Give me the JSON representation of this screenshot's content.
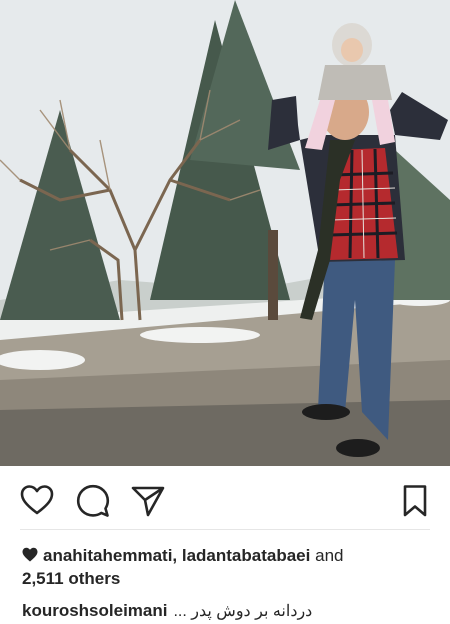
{
  "post": {
    "image_alt": "",
    "likes": {
      "users": "anahitahemmati, ladantabatabaei",
      "joiner": "and",
      "count_text": "2,511 others"
    },
    "caption": {
      "username": "kouroshsoleimani",
      "text": "دردانه بر دوش پدر ..."
    }
  },
  "actions": {
    "like_icon": "heart-outline-icon",
    "comment_icon": "comment-bubble-icon",
    "share_icon": "paper-plane-icon",
    "save_icon": "bookmark-icon"
  },
  "colors": {
    "text": "#262626",
    "divider": "#e6e6e6",
    "background": "#ffffff"
  }
}
